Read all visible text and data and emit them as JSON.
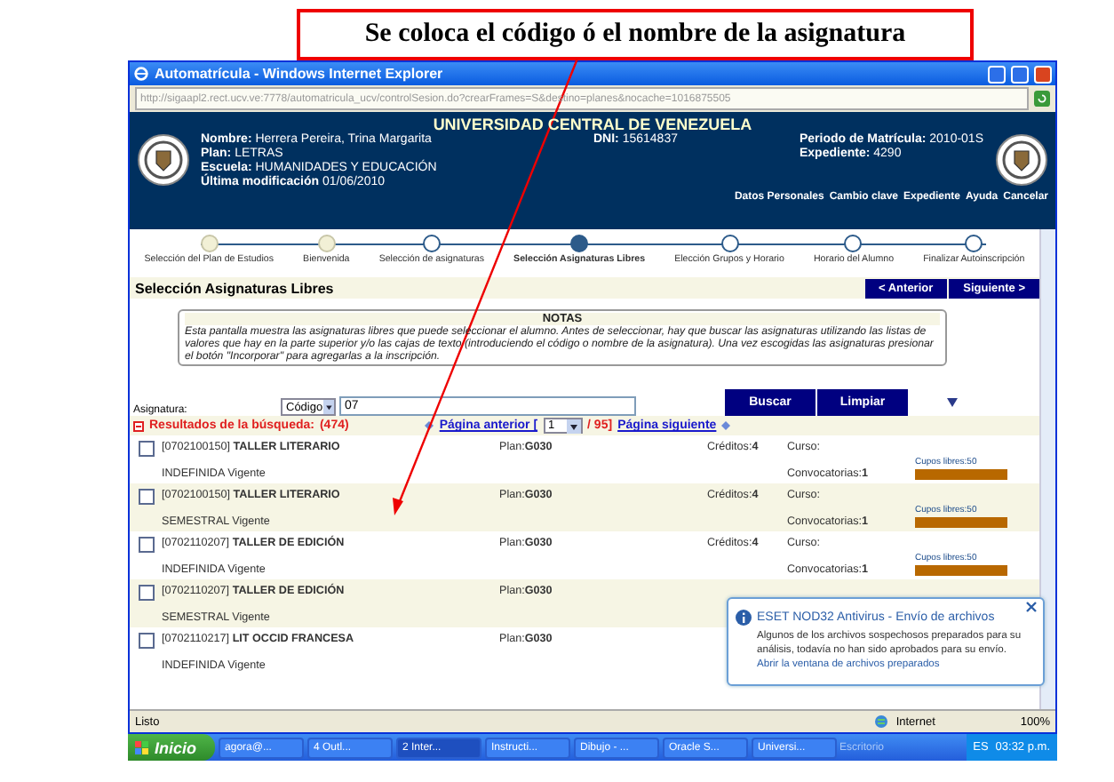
{
  "callout": {
    "text": "Se coloca el código ó el nombre de la asignatura"
  },
  "window": {
    "title": "Automatrícula - Windows Internet Explorer",
    "address": "http://sigaapl2.rect.ucv.ve:7778/automatricula_ucv/controlSesion.do?crearFrames=S&destino=planes&nocache=1016875505"
  },
  "header": {
    "university": "UNIVERSIDAD CENTRAL DE VENEZUELA",
    "left": [
      {
        "label": "Nombre:",
        "value": "Herrera Pereira, Trina Margarita"
      },
      {
        "label": "Plan:",
        "value": "LETRAS"
      },
      {
        "label": "Escuela:",
        "value": "HUMANIDADES Y EDUCACIÓN"
      },
      {
        "label": "Última modificación",
        "value": "01/06/2010"
      }
    ],
    "middle": [
      {
        "label": "DNI:",
        "value": "15614837"
      }
    ],
    "right": [
      {
        "label": "Periodo de Matrícula:",
        "value": "2010-01S"
      },
      {
        "label": "Expediente:",
        "value": "4290"
      }
    ],
    "links": [
      "Datos Personales",
      "Cambio clave",
      "Expediente",
      "Ayuda",
      "Cancelar"
    ]
  },
  "steps": [
    {
      "label": "Selección del Plan de Estudios",
      "kind": "done"
    },
    {
      "label": "Bienvenida",
      "kind": "done"
    },
    {
      "label": "Selección de asignaturas",
      "kind": "pending"
    },
    {
      "label": "Selección Asignaturas Libres",
      "kind": "current"
    },
    {
      "label": "Elección Grupos y Horario",
      "kind": "pending"
    },
    {
      "label": "Horario del Alumno",
      "kind": "pending"
    },
    {
      "label": "Finalizar Autoinscripción",
      "kind": "pending"
    }
  ],
  "section": {
    "title": "Selección Asignaturas Libres",
    "buttons": [
      "< Anterior",
      "Siguiente >"
    ]
  },
  "notes": {
    "title": "NOTAS",
    "text": "Esta pantalla muestra las asignaturas libres que puede seleccionar el alumno. Antes de seleccionar, hay que buscar las asignaturas utilizando las listas de valores que hay en la parte superior y/o las cajas de texto (introduciendo el código o nombre de la asignatura). Una vez escogidas las asignaturas presionar el botón \"Incorporar\" para agregarlas a la inscripción."
  },
  "search": {
    "label": "Asignatura:",
    "select": "Código",
    "value": "07",
    "buttons": [
      "Buscar",
      "Limpiar"
    ]
  },
  "results": {
    "title": "Resultados de la búsqueda:",
    "count": "(474)",
    "prev": "Página anterior [",
    "page": "1",
    "total": "/ 95]",
    "next": "Página siguiente"
  },
  "rows": [
    {
      "checked": false,
      "code": "[0702100150]",
      "name": "TALLER LITERARIO",
      "plan_label": "Plan:",
      "plan": "G030",
      "credits_label": "Créditos:",
      "credits": "4",
      "curso_label": "Curso:",
      "type": "INDEFINIDA Vigente",
      "conv_label": "Convocatorias:",
      "conv": "1",
      "cupos": "Cupos libres:50",
      "level": 1
    },
    {
      "checked": false,
      "code": "[0702100150]",
      "name": "TALLER LITERARIO",
      "plan_label": "Plan:",
      "plan": "G030",
      "credits_label": "Créditos:",
      "credits": "4",
      "curso_label": "Curso:",
      "type": "SEMESTRAL Vigente",
      "conv_label": "Convocatorias:",
      "conv": "1",
      "cupos": "Cupos libres:50",
      "level": 1
    },
    {
      "checked": false,
      "code": "[0702110207]",
      "name": "TALLER DE EDICIÓN",
      "plan_label": "Plan:",
      "plan": "G030",
      "credits_label": "Créditos:",
      "credits": "4",
      "curso_label": "Curso:",
      "type": "INDEFINIDA Vigente",
      "conv_label": "Convocatorias:",
      "conv": "1",
      "cupos": "Cupos libres:50",
      "level": 1
    },
    {
      "checked": false,
      "code": "[0702110207]",
      "name": "TALLER DE EDICIÓN",
      "plan_label": "Plan:",
      "plan": "G030",
      "type": "SEMESTRAL Vigente"
    },
    {
      "checked": false,
      "code": "[0702110217]",
      "name": "LIT OCCID FRANCESA",
      "plan_label": "Plan:",
      "plan": "G030",
      "type": "INDEFINIDA Vigente"
    }
  ],
  "notification": {
    "title": "ESET NOD32 Antivirus - Envío de archivos",
    "text": "Algunos de los archivos sospechosos preparados para su análisis, todavía no han sido aprobados para su envío.",
    "link": "Abrir la ventana de archivos preparados"
  },
  "status_bar": {
    "text": "Listo",
    "zone": "Internet",
    "zoom": "100%"
  },
  "taskbar": {
    "start": "Inicio",
    "tasks": [
      {
        "label": "agora@...",
        "selected": false
      },
      {
        "label": "4 Outl...",
        "selected": false
      },
      {
        "label": "2 Inter...",
        "selected": true
      },
      {
        "label": "Instructi...",
        "selected": false
      },
      {
        "label": "Dibujo - ...",
        "selected": false
      },
      {
        "label": "Oracle S...",
        "selected": false
      },
      {
        "label": "Universi...",
        "selected": false
      }
    ],
    "desktop": "Escritorio",
    "lang": "ES",
    "clock": "03:32 p.m."
  }
}
